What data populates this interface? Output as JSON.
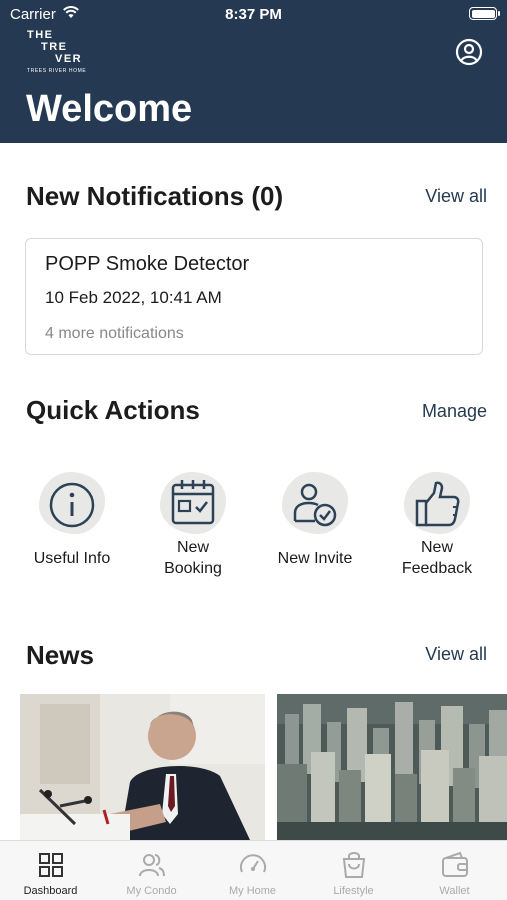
{
  "status_bar": {
    "carrier": "Carrier",
    "time": "8:37 PM"
  },
  "logo": {
    "line1": "THE",
    "line2": "TRE",
    "line3": "VER",
    "tagline": "TREES RIVER HOME"
  },
  "header": {
    "title": "Welcome"
  },
  "notifications": {
    "title": "New Notifications (0)",
    "view_all": "View all",
    "card": {
      "title": "POPP Smoke Detector",
      "time": "10 Feb 2022, 10:41 AM",
      "more": "4 more notifications"
    }
  },
  "quick_actions": {
    "title": "Quick Actions",
    "manage": "Manage",
    "items": [
      {
        "label": "Useful Info",
        "icon": "info-icon"
      },
      {
        "label_line1": "New",
        "label_line2": "Booking",
        "icon": "calendar-icon"
      },
      {
        "label": "New Invite",
        "icon": "invite-icon"
      },
      {
        "label_line1": "New",
        "label_line2": "Feedback",
        "icon": "thumbs-up-icon"
      }
    ]
  },
  "news": {
    "title": "News",
    "view_all": "View all"
  },
  "tabbar": {
    "items": [
      {
        "label": "Dashboard",
        "icon": "grid-icon"
      },
      {
        "label": "My Condo",
        "icon": "people-icon"
      },
      {
        "label": "My Home",
        "icon": "gauge-icon"
      },
      {
        "label": "Lifestyle",
        "icon": "bag-icon"
      },
      {
        "label": "Wallet",
        "icon": "wallet-icon"
      }
    ]
  },
  "colors": {
    "header_bg": "#253a52",
    "accent": "#253a52",
    "icon_stroke": "#2d4257",
    "muted": "#888888"
  }
}
